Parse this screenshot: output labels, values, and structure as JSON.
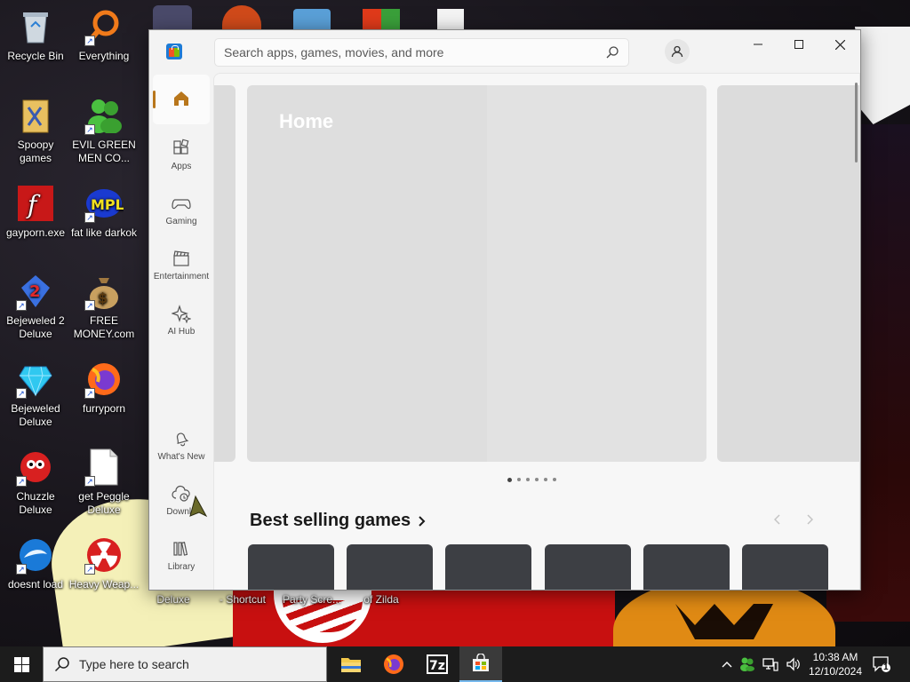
{
  "desktop": {
    "icons": [
      {
        "label": "Recycle Bin",
        "icon": "recycle-bin-icon"
      },
      {
        "label": "Everything",
        "icon": "everything-icon"
      },
      {
        "label": "Spoopy games",
        "icon": "folder-icon"
      },
      {
        "label": "EVIL GREEN MEN CO...",
        "icon": "green-men-icon"
      },
      {
        "label": "gayporn.exe",
        "icon": "flash-icon"
      },
      {
        "label": "fat like darkok",
        "icon": "mpl-icon"
      },
      {
        "label": "Bejeweled 2 Deluxe",
        "icon": "bejeweled2-icon"
      },
      {
        "label": "FREE MONEY.com",
        "icon": "money-bag-icon"
      },
      {
        "label": "Bejeweled Deluxe",
        "icon": "bejeweled-icon"
      },
      {
        "label": "furryporn",
        "icon": "firefox-icon"
      },
      {
        "label": "Chuzzle Deluxe",
        "icon": "chuzzle-icon"
      },
      {
        "label": "get Peggle Deluxe",
        "icon": "document-icon"
      },
      {
        "label": "doesnt load",
        "icon": "thunderbird-icon"
      },
      {
        "label": "Heavy Weap...",
        "icon": "radiation-icon"
      }
    ],
    "bottom_labels": [
      {
        "label": "Deluxe"
      },
      {
        "label": "- Shortcut"
      },
      {
        "label": "Party Scre..."
      },
      {
        "label": "of Zilda"
      }
    ]
  },
  "window": {
    "search_placeholder": "Search apps, games, movies, and more",
    "nav": [
      {
        "label": "Apps",
        "icon": "apps-icon"
      },
      {
        "label": "Gaming",
        "icon": "gamepad-icon"
      },
      {
        "label": "Entertainment",
        "icon": "clapperboard-icon"
      },
      {
        "label": "AI Hub",
        "icon": "sparkle-icon"
      },
      {
        "label": "What's New",
        "icon": "bell-icon"
      },
      {
        "label": "Downlo",
        "icon": "cloud-download-icon"
      },
      {
        "label": "Library",
        "icon": "library-icon"
      }
    ],
    "hero_title": "Home",
    "section_title": "Best selling games",
    "carousel_dots": 6,
    "cards": 6
  },
  "taskbar": {
    "search_placeholder": "Type here to search",
    "clock_time": "10:38 AM",
    "clock_date": "12/10/2024",
    "notification_count": "1"
  }
}
